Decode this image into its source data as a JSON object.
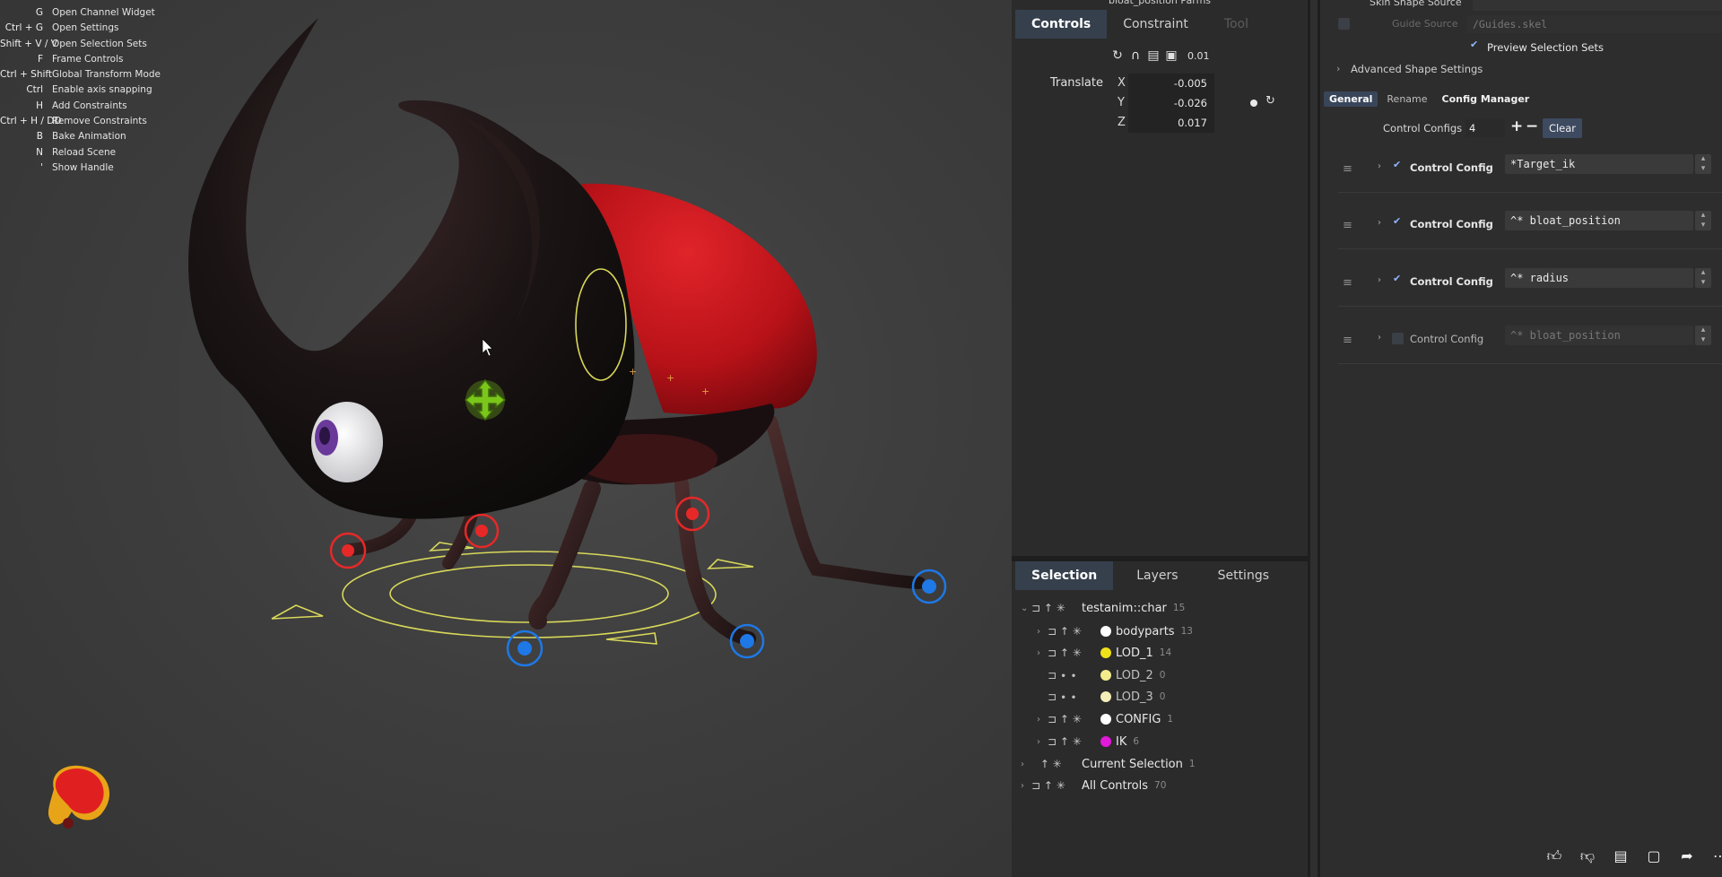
{
  "hotkeys": [
    {
      "key": "G",
      "action": "Open Channel Widget"
    },
    {
      "key": "Ctrl + G",
      "action": "Open Settings"
    },
    {
      "key": "Shift + V / V",
      "action": "Open Selection Sets"
    },
    {
      "key": "F",
      "action": "Frame Controls"
    },
    {
      "key": "Ctrl + Shift",
      "action": "Global Transform Mode"
    },
    {
      "key": "Ctrl",
      "action": "Enable axis snapping"
    },
    {
      "key": "H",
      "action": "Add Constraints"
    },
    {
      "key": "Ctrl + H / DD",
      "action": "Remove Constraints"
    },
    {
      "key": "B",
      "action": "Bake Animation"
    },
    {
      "key": "N",
      "action": "Reload Scene"
    },
    {
      "key": "'",
      "action": "Show Handle"
    }
  ],
  "controls_panel": {
    "title": "bloat_position Parms",
    "tabs": [
      {
        "label": "Controls",
        "state": "active"
      },
      {
        "label": "Constraint",
        "state": "normal"
      },
      {
        "label": "Tool",
        "state": "disabled"
      }
    ],
    "step_value": "0.01",
    "translate": {
      "label": "Translate",
      "axes": [
        {
          "axis": "X",
          "value": "-0.005"
        },
        {
          "axis": "Y",
          "value": "-0.026"
        },
        {
          "axis": "Z",
          "value": "0.017"
        }
      ]
    }
  },
  "outliner": {
    "tabs": [
      {
        "label": "Selection",
        "state": "active"
      },
      {
        "label": "Layers",
        "state": "normal"
      },
      {
        "label": "Settings",
        "state": "normal"
      }
    ],
    "rows": [
      {
        "label": "testanim::char",
        "count": "15",
        "color": null,
        "expanded": true
      },
      {
        "label": "bodyparts",
        "count": "13",
        "color": "#ffffff"
      },
      {
        "label": "LOD_1",
        "count": "14",
        "color": "#f0e21a"
      },
      {
        "label": "LOD_2",
        "count": "0",
        "color": "#f2ec8c"
      },
      {
        "label": "LOD_3",
        "count": "0",
        "color": "#f4f0b8"
      },
      {
        "label": "CONFIG",
        "count": "1",
        "color": "#ffffff"
      },
      {
        "label": "IK",
        "count": "6",
        "color": "#e01ad8"
      },
      {
        "label": "Current Selection",
        "count": "1",
        "color": null
      },
      {
        "label": "All Controls",
        "count": "70",
        "color": null
      }
    ]
  },
  "right_panel": {
    "skin_shape_source": "Skin Shape Source",
    "guide_source_label": "Guide Source",
    "guide_source_value": "/Guides.skel",
    "preview_selection_sets": "Preview Selection Sets",
    "advanced_shape_settings": "Advanced Shape Settings",
    "subtabs": [
      {
        "label": "General",
        "state": "active"
      },
      {
        "label": "Rename",
        "state": "normal"
      },
      {
        "label": "Config Manager",
        "state": "bold"
      }
    ],
    "control_configs_label": "Control Configs",
    "control_configs_count": "4",
    "clear_label": "Clear",
    "configs": [
      {
        "label": "Control Config",
        "value": "*Target_ik",
        "enabled": true
      },
      {
        "label": "Control Config",
        "value": "^* bloat_position",
        "enabled": true
      },
      {
        "label": "Control Config",
        "value": "^* radius",
        "enabled": true
      },
      {
        "label": "Control Config",
        "value": "^* bloat_position",
        "enabled": false
      }
    ]
  },
  "colors": {
    "active_tab": "#36404d",
    "body_red": "#c8141c",
    "ik_handle_blue": "#1e78e6",
    "ik_handle_red": "#e62828",
    "guide_yellow": "#dcdc50",
    "move_gizmo_green": "#7bc61a"
  },
  "icons": [
    "reset-icon",
    "magnet-icon",
    "copy-icon",
    "paste-icon",
    "like-icon",
    "dislike-icon",
    "comment-icon",
    "chat-icon",
    "share-icon",
    "more-icon"
  ]
}
